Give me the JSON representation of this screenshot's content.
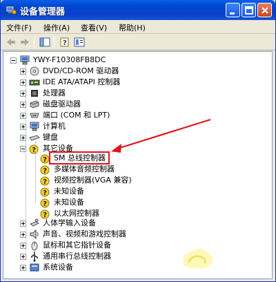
{
  "window": {
    "title": "设备管理器"
  },
  "menu": {
    "file": "文件(F)",
    "action": "操作(A)",
    "view": "查看(V)",
    "help": "帮助(H)"
  },
  "tree": {
    "root": "YWY-F10308FB8DC",
    "items": [
      {
        "label": "DVD/CD-ROM 驱动器",
        "icon": "cdrom-icon"
      },
      {
        "label": "IDE ATA/ATAPI 控制器",
        "icon": "ide-controller-icon"
      },
      {
        "label": "处理器",
        "icon": "processor-icon"
      },
      {
        "label": "磁盘驱动器",
        "icon": "disk-drive-icon"
      },
      {
        "label": "端口 (COM 和 LPT)",
        "icon": "port-icon"
      },
      {
        "label": "计算机",
        "icon": "computer-icon"
      },
      {
        "label": "键盘",
        "icon": "keyboard-icon"
      },
      {
        "label": "其它设备",
        "icon": "unknown-device-icon"
      }
    ],
    "other_devices": [
      {
        "label": "SM 总线控制器"
      },
      {
        "label": "多媒体音频控制器"
      },
      {
        "label": "视频控制器(VGA 兼容)"
      },
      {
        "label": "未知设备"
      },
      {
        "label": "未知设备"
      },
      {
        "label": "以太网控制器"
      }
    ],
    "after": [
      {
        "label": "人体学输入设备",
        "icon": "hid-icon"
      },
      {
        "label": "声音、视频和游戏控制器",
        "icon": "sound-icon"
      },
      {
        "label": "鼠标和其它指针设备",
        "icon": "mouse-icon"
      },
      {
        "label": "通用串行总线控制器",
        "icon": "usb-icon"
      },
      {
        "label": "系统设备",
        "icon": "system-device-icon"
      }
    ]
  },
  "colors": {
    "highlight": "#e0141e",
    "titlebar": "#0047d4"
  }
}
